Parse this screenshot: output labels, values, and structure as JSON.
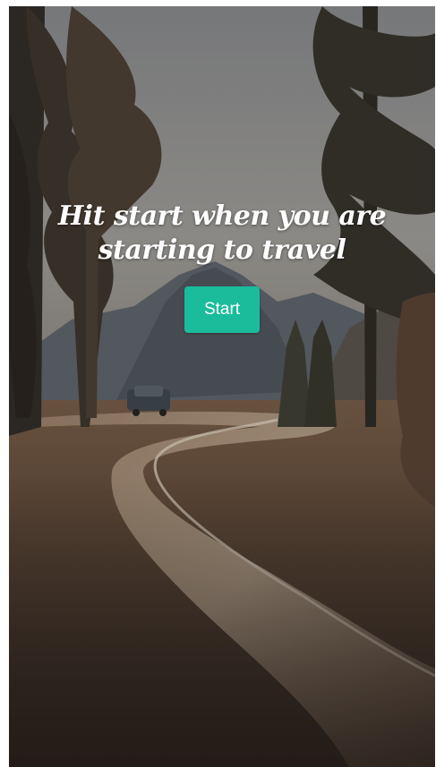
{
  "hero": {
    "title": "Hit start when you are starting to travel",
    "start_label": "Start"
  },
  "colors": {
    "accent": "#1abc9c",
    "text": "#ffffff",
    "overlay": "#2b2320"
  },
  "background": {
    "scene": "forest road with mountain"
  }
}
